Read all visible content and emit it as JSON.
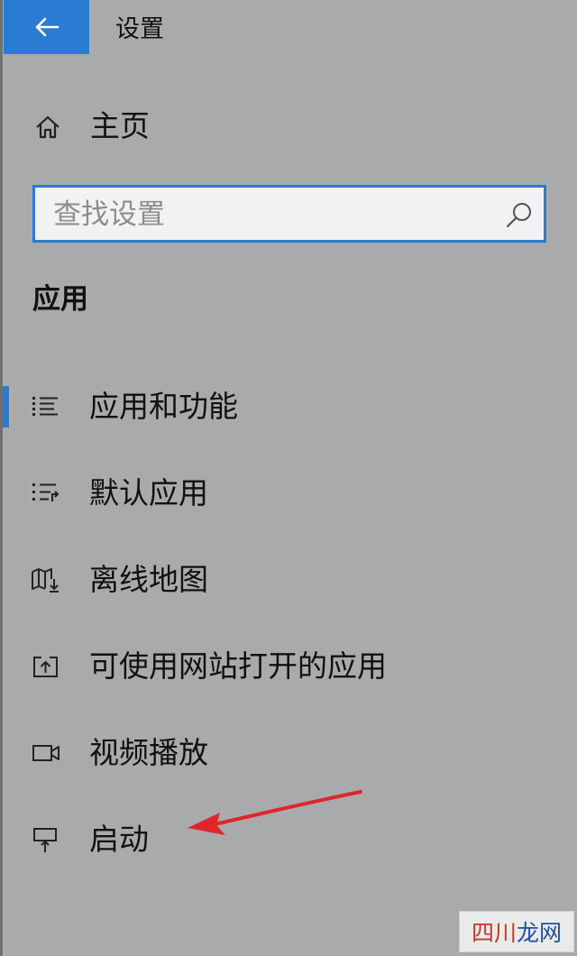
{
  "window": {
    "title": "设置"
  },
  "home": {
    "label": "主页",
    "icon": "home-icon"
  },
  "search": {
    "value": "",
    "placeholder": "查找设置",
    "icon": "search-icon"
  },
  "section": {
    "title": "应用"
  },
  "nav": {
    "items": [
      {
        "label": "应用和功能",
        "icon": "list-icon",
        "selected": true
      },
      {
        "label": "默认应用",
        "icon": "default-apps-icon",
        "selected": false
      },
      {
        "label": "离线地图",
        "icon": "map-download-icon",
        "selected": false
      },
      {
        "label": "可使用网站打开的应用",
        "icon": "open-in-app-icon",
        "selected": false
      },
      {
        "label": "视频播放",
        "icon": "video-camera-icon",
        "selected": false
      },
      {
        "label": "启动",
        "icon": "startup-icon",
        "selected": false
      }
    ]
  },
  "watermark": {
    "text_part1": "四川",
    "text_part2": "龙网"
  },
  "colors": {
    "accent": "#2a7cd3",
    "background": "#a9aaab",
    "annotation_arrow": "#e0262a"
  }
}
